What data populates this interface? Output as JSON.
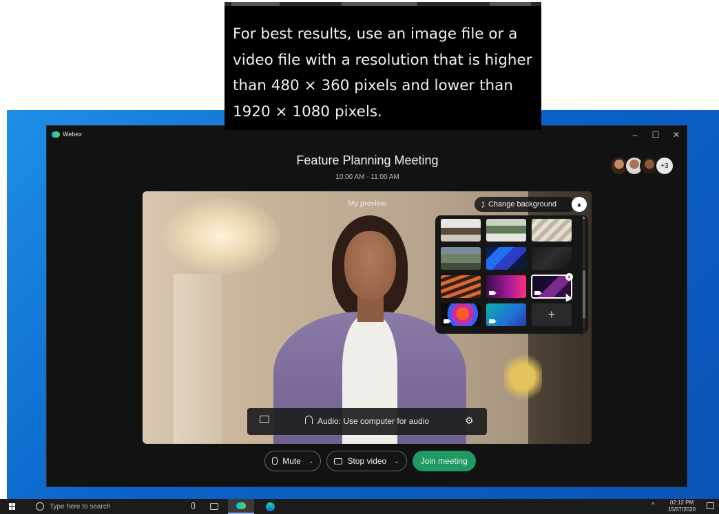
{
  "callout": {
    "lines": [
      "For best results, use an image file or a",
      "video file with a resolution that is higher",
      "than 480 × 360 pixels and lower than",
      "1920 × 1080 pixels."
    ]
  },
  "window": {
    "app_name": "Webex",
    "minimize": "–",
    "maximize": "☐",
    "close": "✕"
  },
  "meeting": {
    "title": "Feature Planning Meeting",
    "time": "10:00 AM - 11:00 AM",
    "extra_participants": "+3"
  },
  "preview": {
    "label": "My preview",
    "change_background_label": "Change background",
    "collapse_icon": "▲"
  },
  "picker": {
    "add_label": "+",
    "scroll_up": "▲",
    "scroll_down": "⌄"
  },
  "audio": {
    "label": "Audio: Use computer for audio",
    "gear": "⚙"
  },
  "controls": {
    "mute_label": "Mute",
    "stop_video_label": "Stop video",
    "join_label": "Join meeting",
    "chevron": "⌄"
  },
  "taskbar": {
    "search_placeholder": "Type here to search",
    "time": "02:12 PM",
    "date": "15/07/2020",
    "tray_arrow": "^"
  },
  "colors": {
    "join_button": "#1e9b62",
    "desktop_blue": "#0a63c9",
    "window_bg": "#121212"
  }
}
